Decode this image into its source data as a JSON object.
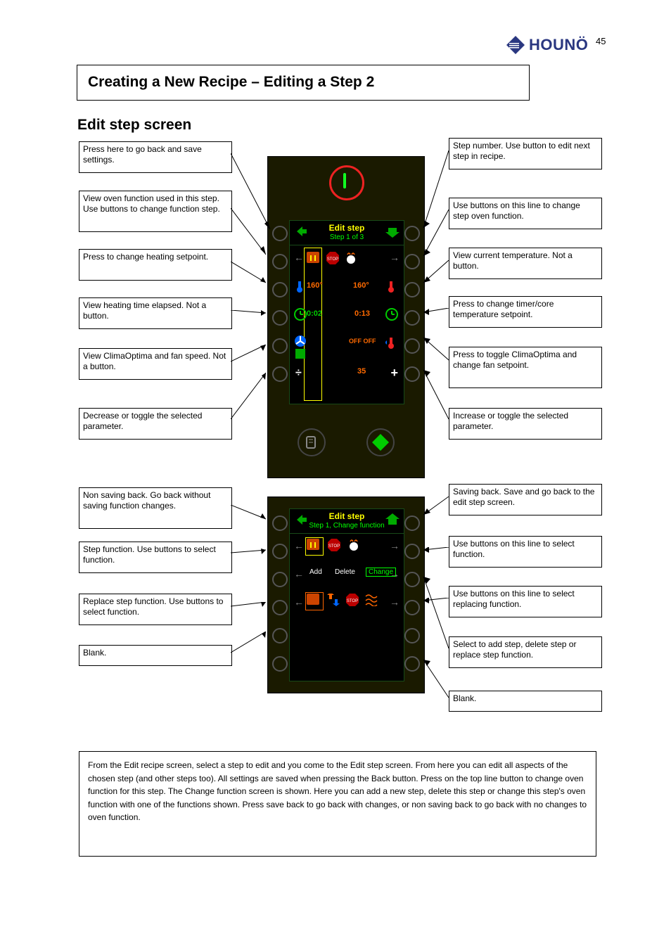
{
  "page_number": "45",
  "brand": "HOUNÖ",
  "heading": "Creating a New Recipe – Editing a Step   2",
  "subheading": "Edit step screen",
  "panel1": {
    "title": "Edit step",
    "subtitle": "Step 1 of 3",
    "temp_left": "160°",
    "temp_right": "160°",
    "time_left": "0:02",
    "time_right": "0:13",
    "off_off": "OFF OFF",
    "humidity": "35"
  },
  "panel2": {
    "title": "Edit step",
    "subtitle": "Step 1, Change function",
    "add": "Add",
    "delete": "Delete",
    "change": "Change"
  },
  "callouts1_left": [
    "Press here to go back and save settings.",
    "View oven function used in this step. Use buttons to change function step.",
    "Press to change heating setpoint.",
    "View heating time elapsed. Not a button.",
    "View ClimaOptima and fan speed. Not a button.",
    "Decrease or toggle the selected parameter."
  ],
  "callouts1_right": [
    "Step number. Use button to edit next step in recipe.",
    "Use buttons on this line to change step oven function.",
    "View current temperature. Not a button.",
    "Press to change timer/core temperature setpoint.",
    "Press to toggle ClimaOptima and change fan setpoint.",
    "Increase or toggle the selected parameter."
  ],
  "callouts2_left": [
    "Non saving back. Go back without saving function changes.",
    "Step function. Use buttons to select function.",
    "Replace step function. Use buttons to select function.",
    "Blank."
  ],
  "callouts2_right": [
    "Saving back. Save and go back to the edit step screen.",
    "Use buttons on this line to select function.",
    "Use buttons on this line to select replacing function.",
    "Select to add step, delete step or replace step function.",
    "Blank."
  ],
  "footnote": "From the Edit recipe screen, select a step to edit and you come to the Edit step screen. From here you can edit all aspects of the chosen step (and other steps too). All settings are saved when pressing the Back button. Press on the top line button to change oven function for this step. The Change function screen is shown. Here you can add a new step, delete this step or change this step's oven function with one of the functions shown. Press save back to go back with changes, or non saving back to go back with no changes to oven function."
}
